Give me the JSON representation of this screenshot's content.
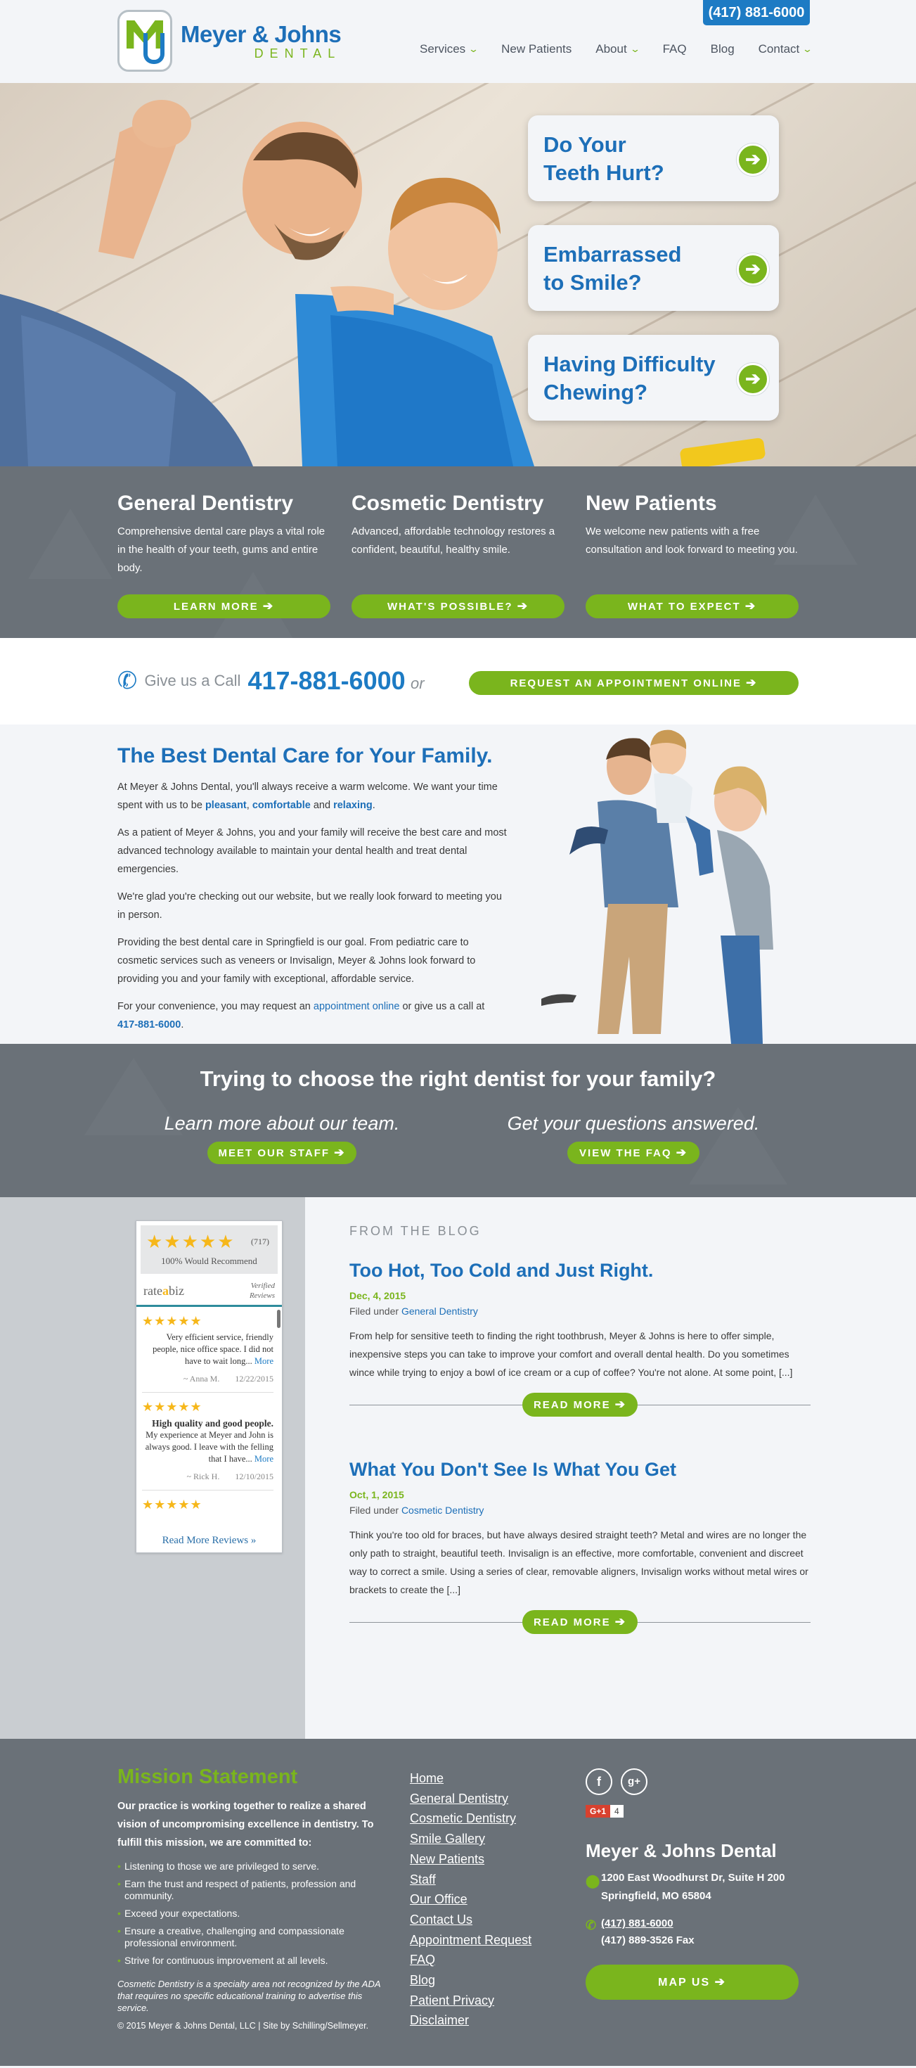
{
  "header": {
    "brand_name": "Meyer & Johns",
    "brand_sub": "DENTAL",
    "phone": "(417) 881-6000",
    "nav": [
      {
        "label": "Services",
        "dropdown": true
      },
      {
        "label": "New Patients",
        "dropdown": false
      },
      {
        "label": "About",
        "dropdown": true
      },
      {
        "label": "FAQ",
        "dropdown": false
      },
      {
        "label": "Blog",
        "dropdown": false
      },
      {
        "label": "Contact",
        "dropdown": true
      }
    ],
    "chevron": "⌄"
  },
  "hero": {
    "cards": [
      {
        "line1": "Do Your",
        "line2": "Teeth Hurt?"
      },
      {
        "line1": "Embarrassed",
        "line2": "to Smile?"
      },
      {
        "line1": "Having Difficulty",
        "line2": "Chewing?"
      }
    ],
    "arrow_icon": "arrow-right-icon",
    "arrow_glyph": "➔"
  },
  "services": [
    {
      "title": "General Dentistry",
      "desc": "Comprehensive dental care plays a vital role in the health of your teeth, gums and entire body.",
      "button": "LEARN MORE"
    },
    {
      "title": "Cosmetic Dentistry",
      "desc": "Advanced, affordable technology restores a confident, beautiful, healthy smile.",
      "button": "WHAT'S POSSIBLE?"
    },
    {
      "title": "New Patients",
      "desc": "We welcome new patients with a free consultation and look forward to meeting you.",
      "button": "WHAT TO EXPECT"
    }
  ],
  "arrow": "➔",
  "callbar": {
    "give_text": "Give us a Call",
    "phone": "417-881-6000",
    "or": "or",
    "button": "REQUEST AN APPOINTMENT ONLINE"
  },
  "about": {
    "title": "The Best Dental Care for Your Family.",
    "p1_pre": "At Meyer & Johns Dental, you'll always receive a warm welcome. We want your time spent with us to be ",
    "p1_w1": "pleasant",
    "p1_c1": ", ",
    "p1_w2": "comfortable",
    "p1_and": " and ",
    "p1_w3": "relaxing",
    "p1_end": ".",
    "p2": "As a patient of Meyer & Johns, you and your family will receive the best care and most advanced technology available to maintain your dental health and treat dental emergencies.",
    "p3": "We're glad you're checking out our website, but we really look forward to meeting you in person.",
    "p4": "Providing the best dental care in Springfield is our goal. From pediatric care to cosmetic services such as veneers or Invisalign, Meyer & Johns look forward to providing you and your family with exceptional, affordable service.",
    "p5_pre": "For your convenience, you may request an ",
    "p5_link": "appointment online",
    "p5_mid": " or give us a call at ",
    "p5_phone": "417-881-6000",
    "p5_end": "."
  },
  "choose": {
    "title": "Trying to choose the right dentist for your family?",
    "left_label": "Learn more about our team.",
    "left_button": "MEET OUR STAFF",
    "right_label": "Get your questions answered.",
    "right_button": "VIEW THE FAQ"
  },
  "reviews": {
    "stars": "★★★★★",
    "count": "(717)",
    "recommend": "100% Would Recommend",
    "brand_pre": "rate",
    "brand_a": "a",
    "brand_post": "biz",
    "verified_1": "Verified",
    "verified_2": "Reviews",
    "items": [
      {
        "stars": "★★★★★",
        "title": "",
        "text": "Very efficient service, friendly people, nice office space. I did not have to wait long...",
        "more": "More",
        "author": "~ Anna M.",
        "date": "12/22/2015"
      },
      {
        "stars": "★★★★★",
        "title": "High quality and good people.",
        "text": "My experience at Meyer and John is always good. I leave with the felling that I have...",
        "more": "More",
        "author": "~ Rick H.",
        "date": "12/10/2015"
      },
      {
        "stars": "★★★★★",
        "title": "",
        "text": "",
        "more": "",
        "author": "",
        "date": ""
      }
    ],
    "read_more": "Read More Reviews »"
  },
  "blog": {
    "heading": "FROM THE BLOG",
    "posts": [
      {
        "title": "Too Hot, Too Cold and Just Right.",
        "date": "Dec, 4, 2015",
        "filed": "Filed under ",
        "category": "General Dentistry",
        "excerpt": "From help for sensitive teeth to finding the right toothbrush, Meyer & Johns is here to offer simple, inexpensive steps you can take to improve your comfort and overall dental health. Do you sometimes wince while trying to enjoy a bowl of ice cream or a cup of coffee? You're not alone. At some point, [...]",
        "button": "READ MORE"
      },
      {
        "title": "What You Don't See Is What You Get",
        "date": "Oct, 1, 2015",
        "filed": "Filed under ",
        "category": "Cosmetic Dentistry",
        "excerpt": "Think you're too old for braces, but have always desired straight teeth? Metal and wires are no longer the only path to straight, beautiful teeth. Invisalign is an effective, more comfortable, convenient and discreet way to correct a smile. Using a series of clear, removable aligners, Invisalign works without metal wires or brackets to create the [...]",
        "button": "READ MORE"
      }
    ]
  },
  "footer": {
    "mission_title": "Mission Statement",
    "mission_intro": "Our practice is working together to realize a shared vision of uncompromising excellence in dentistry. To fulfill this mission, we are committed to:",
    "mission_items": [
      "Listening to those we are privileged to serve.",
      "Earn the trust and respect of patients, profession and community.",
      "Exceed your expectations.",
      "Ensure a creative, challenging and compassionate professional environment.",
      "Strive for continuous improvement at all levels."
    ],
    "note": "Cosmetic Dentistry is a specialty area not recognized by the ADA that requires no specific educational training to advertise this service.",
    "copyright": "© 2015 Meyer & Johns Dental, LLC | Site by Schilling/Sellmeyer.",
    "links": [
      "Home",
      "General Dentistry",
      "Cosmetic Dentistry",
      "Smile Gallery",
      "New Patients",
      "Staff",
      "Our Office",
      "Contact Us",
      "Appointment Request",
      "FAQ",
      "Blog",
      "Patient Privacy",
      "Disclaimer"
    ],
    "social_f": "f",
    "social_g": "g+",
    "gplus_label": "G+1",
    "gplus_count": "4",
    "name": "Meyer & Johns Dental",
    "addr1": "1200 East Woodhurst Dr, Suite H 200",
    "addr2": "Springfield, MO 65804",
    "phone": "(417) 881-6000",
    "fax": "(417) 889-3526 Fax",
    "map_button": "MAP US"
  },
  "colors": {
    "blue": "#1d6fb8",
    "green": "#7ab51d",
    "slate": "#6a7178",
    "light": "#f3f5f8"
  }
}
